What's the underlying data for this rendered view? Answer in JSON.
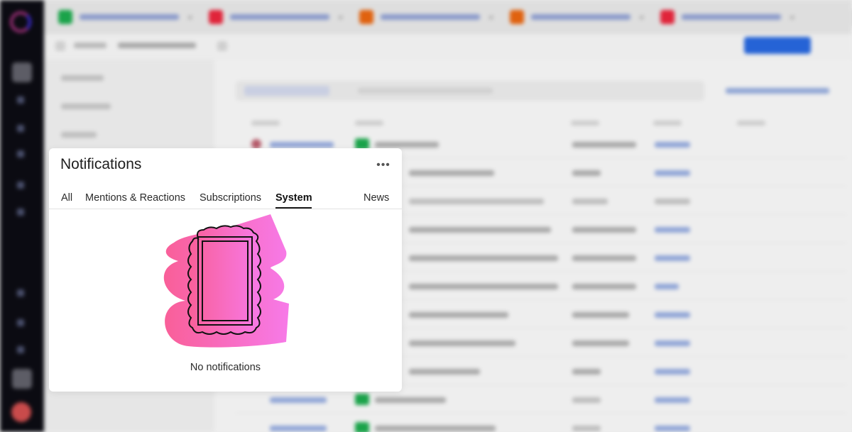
{
  "colors": {
    "accent": "#2563d6",
    "illustration_pink": "#f95fa8",
    "illustration_magenta": "#f77ae8",
    "tab_green": "#1aa34a",
    "tab_red": "#e0243a",
    "tab_orange": "#e0620f"
  },
  "notifications": {
    "title": "Notifications",
    "more_icon": "ellipsis-icon",
    "tabs": [
      {
        "label": "All",
        "active": false
      },
      {
        "label": "Mentions & Reactions",
        "active": false
      },
      {
        "label": "Subscriptions",
        "active": false
      },
      {
        "label": "System",
        "active": true
      },
      {
        "label": "News",
        "active": false
      }
    ],
    "empty_illustration": "picture-frame-illustration",
    "empty_text": "No notifications"
  }
}
